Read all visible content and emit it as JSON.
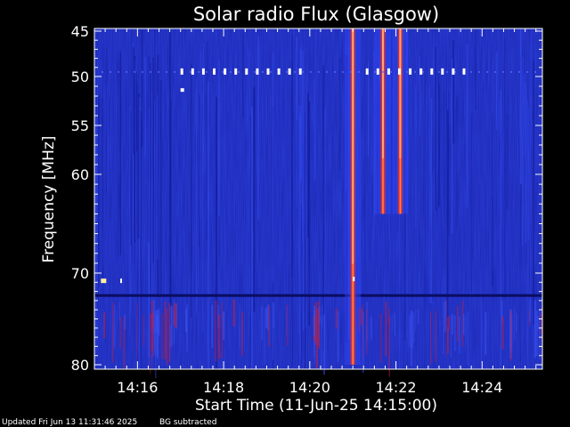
{
  "chart_data": {
    "type": "heatmap",
    "title": "Solar radio Flux (Glasgow)",
    "xlabel": "Start Time (11-Jun-25 14:15:00)",
    "ylabel": "Frequency [MHz]",
    "x_tick_labels": [
      "14:16",
      "14:18",
      "14:20",
      "14:22",
      "14:24"
    ],
    "x_ticks_minutes": [
      16,
      18,
      20,
      22,
      24
    ],
    "x_range_minutes": [
      15,
      25.4
    ],
    "y_ticks": [
      45,
      50,
      55,
      60,
      70,
      80
    ],
    "y_range": [
      45,
      80
    ],
    "y_scale": "non-linear (compressed toward high frequencies)",
    "background_color": "#1a26b0",
    "burst_color": "#e02010",
    "bursts": [
      {
        "time_minutes": 21.0,
        "freq_start": 45,
        "freq_end": 80,
        "intensity": "strong"
      },
      {
        "time_minutes": 21.7,
        "freq_start": 45,
        "freq_end": 64,
        "intensity": "strong"
      },
      {
        "time_minutes": 22.1,
        "freq_start": 45,
        "freq_end": 64,
        "intensity": "strong"
      }
    ],
    "interference_band_mhz": 49.5,
    "footer": {
      "updated": "Updated Fri Jun 13 11:31:46 2025",
      "note": "BG subtracted"
    }
  }
}
